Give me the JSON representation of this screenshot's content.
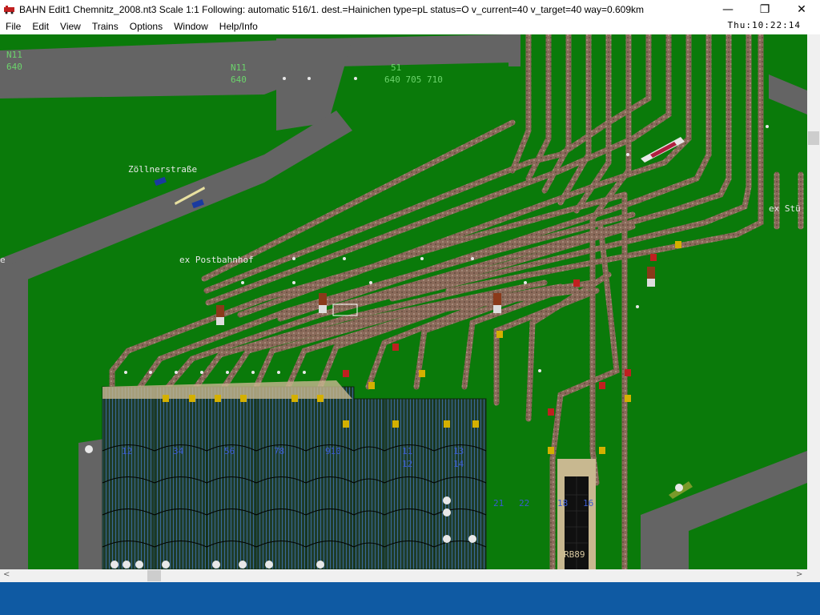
{
  "window": {
    "title": "BAHN Edit1 Chemnitz_2008.nt3 Scale 1:1 Following: automatic 516/1.  dest.=Hainichen type=pL status=O  v_current=40 v_target=40 way=0.609km",
    "minimize_glyph": "—",
    "maximize_glyph": "❐",
    "close_glyph": "✕"
  },
  "menu": {
    "items": [
      "File",
      "Edit",
      "View",
      "Trains",
      "Options",
      "Window",
      "Help/Info"
    ],
    "clock": "Thu:10:22:14"
  },
  "map": {
    "labels": {
      "n11_left": "N11",
      "n11_left_num": "640",
      "n11_mid": "N11",
      "n11_mid_num": "640",
      "line51": "51",
      "line51_nums": "640 705 710",
      "zoellnerstrasse": "Zöllnerstraße",
      "postbahnhof": "ex Postbahnhof",
      "ex_stue": "ex Stü",
      "left_edge_e": "e",
      "rb89": "RB89",
      "platform_numbers": [
        "12",
        "34",
        "56",
        "78",
        "910",
        "11",
        "12",
        "13",
        "14",
        "21",
        "22",
        "18",
        "16"
      ]
    },
    "colors": {
      "grass": "#0a7a0a",
      "road": "#646464",
      "track_bed": "#8a6a5a",
      "platform": "#2a4a2a",
      "label_green": "#6cd46c",
      "label_white": "#e8e8e8",
      "signal_yellow": "#d4b000"
    }
  },
  "scrollbars": {
    "left_arrow": "<",
    "right_arrow": ">"
  }
}
